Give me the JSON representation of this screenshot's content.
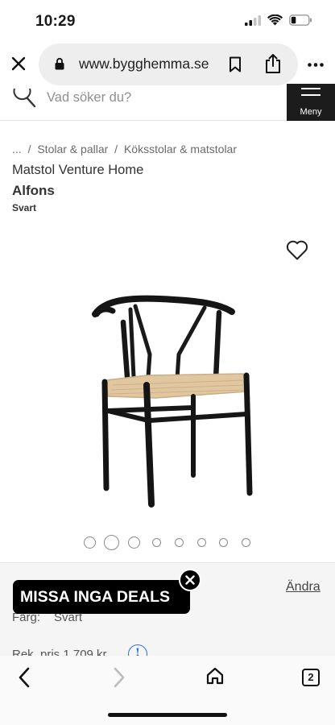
{
  "status_bar": {
    "time": "10:29"
  },
  "browser": {
    "url": "www.bygghemma.se",
    "open_tabs": "2"
  },
  "search": {
    "placeholder": "Vad söker du?"
  },
  "menu": {
    "label": "Meny"
  },
  "breadcrumb": {
    "ellipsis": "...",
    "separator": "/",
    "items": [
      "Stolar & pallar",
      "Köksstolar & matstolar"
    ]
  },
  "product": {
    "category": "Matstol Venture Home",
    "name": "Alfons",
    "variant": "Svart"
  },
  "carousel": {
    "count": 8,
    "active_index": 1
  },
  "options": {
    "change_label": "Ändra",
    "color_label": "Färg:",
    "color_value": "Svart",
    "price_text": "Rek. pris 1 709 kr",
    "info_symbol": "!"
  },
  "banner": {
    "text": "MISSA INGA DEALS"
  },
  "colors": {
    "menu_bg": "#1c1c1c",
    "info_blue": "#2a6fd6",
    "banner_bg": "#000000"
  }
}
